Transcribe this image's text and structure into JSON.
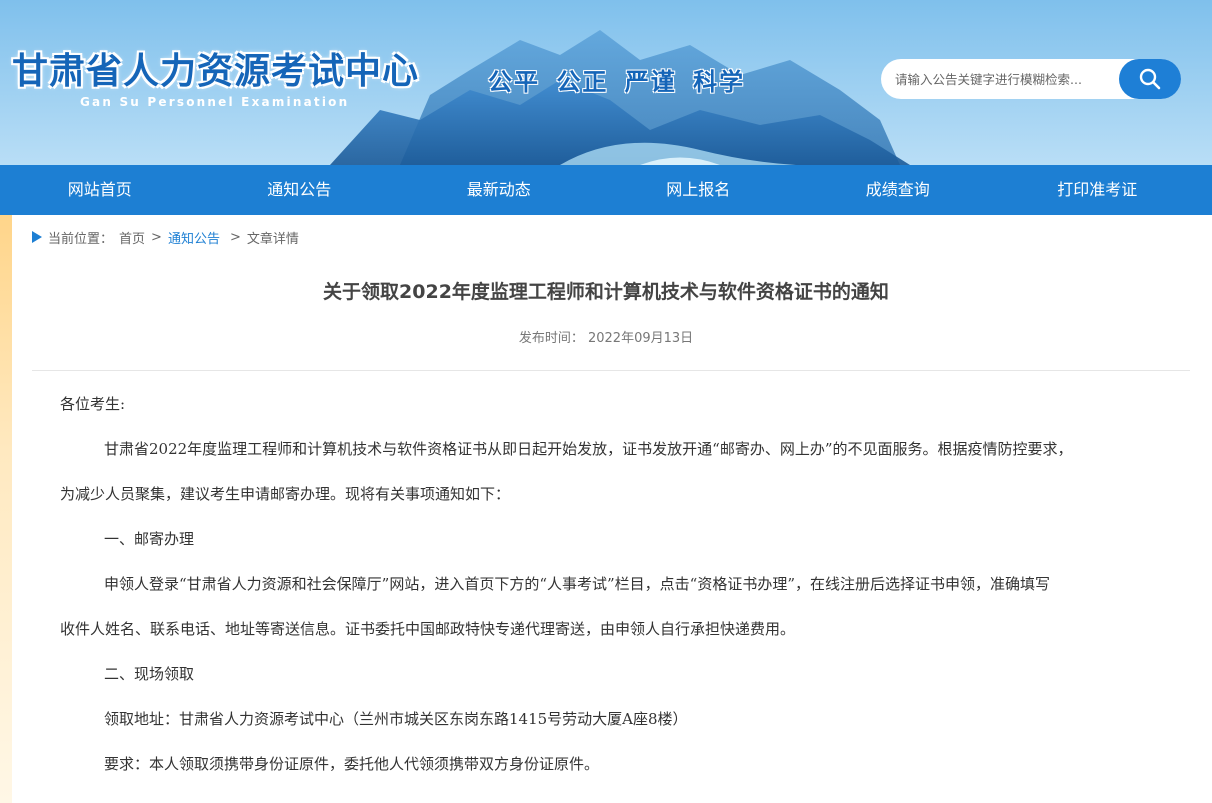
{
  "header": {
    "site_title": "甘肃省人力资源考试中心",
    "site_subtitle": "Gan Su Personnel Examination",
    "motto": "公平 公正 严谨 科学",
    "search_placeholder": "请输入公告关键字进行模糊检索...",
    "search_icon": "search-icon"
  },
  "nav": {
    "items": [
      {
        "label": "网站首页"
      },
      {
        "label": "通知公告"
      },
      {
        "label": "最新动态"
      },
      {
        "label": "网上报名"
      },
      {
        "label": "成绩查询"
      },
      {
        "label": "打印准考证"
      }
    ]
  },
  "breadcrumb": {
    "prefix": "当前位置：",
    "home": "首页",
    "section": "通知公告",
    "current": "文章详情",
    "separator": ">"
  },
  "article": {
    "title": "关于领取2022年度监理工程师和计算机技术与软件资格证书的通知",
    "publish_label": "发布时间：",
    "publish_date": "2022年09月13日",
    "greeting": "各位考生:",
    "p1_line1": "甘肃省2022年度监理工程师和计算机技术与软件资格证书从即日起开始发放，证书发放开通“邮寄办、网上办”的不见面服务。根据疫情防控要求，",
    "p1_line2": "为减少人员聚集，建议考生申请邮寄办理。现将有关事项通知如下：",
    "h1": "一、邮寄办理",
    "p2_line1": "申领人登录“甘肃省人力资源和社会保障厅”网站，进入首页下方的“人事考试”栏目，点击“资格证书办理”，在线注册后选择证书申领，准确填写",
    "p2_line2": "收件人姓名、联系电话、地址等寄送信息。证书委托中国邮政特快专递代理寄送，由申领人自行承担快递费用。",
    "h2": "二、现场领取",
    "p3": "领取地址：甘肃省人力资源考试中心（兰州市城关区东岗东路1415号劳动大厦A座8楼）",
    "p4": "要求：本人领取须携带身份证原件，委托他人代领须携带双方身份证原件。"
  },
  "colors": {
    "nav_bg": "#1d7fd3",
    "accent_blue": "#1565b8",
    "left_accent": "#ffd58a"
  }
}
